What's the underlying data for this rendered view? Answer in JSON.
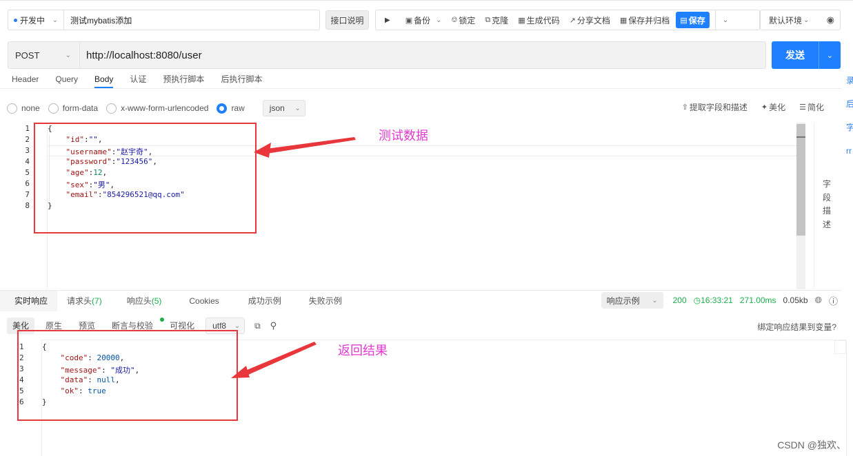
{
  "toolbar": {
    "status": "开发中",
    "api_name": "测试mybatis添加",
    "doc_button": "接口说明",
    "run_icon": "play-icon",
    "items": [
      {
        "icon": "backup-icon",
        "label": "备份"
      },
      {
        "icon": "lock-icon",
        "label": "锁定"
      },
      {
        "icon": "clone-icon",
        "label": "克隆"
      },
      {
        "icon": "code-icon",
        "label": "生成代码"
      },
      {
        "icon": "share-icon",
        "label": "分享文档"
      },
      {
        "icon": "archive-icon",
        "label": "保存并归档"
      }
    ],
    "save_label": "保存",
    "environment": "默认环境"
  },
  "request": {
    "method": "POST",
    "url": "http://localhost:8080/user",
    "send_label": "发送"
  },
  "request_tabs": [
    "Header",
    "Query",
    "Body",
    "认证",
    "预执行脚本",
    "后执行脚本"
  ],
  "body": {
    "types": [
      "none",
      "form-data",
      "x-www-form-urlencoded",
      "raw"
    ],
    "format": "json",
    "actions": [
      "提取字段和描述",
      "美化",
      "简化"
    ],
    "side_label": "字段描述",
    "line_numbers": [
      "1",
      "2",
      "3",
      "4",
      "5",
      "6",
      "7",
      "8"
    ],
    "fields": {
      "id": "\"\"",
      "username": "\"赵宇奇\"",
      "password": "\"123456\"",
      "age": "12",
      "sex": "\"男\"",
      "email": "\"854296521@qq.com\""
    }
  },
  "right_strip": [
    "录",
    "后",
    "字",
    "rr"
  ],
  "response": {
    "tabs": [
      {
        "label": "实时响应",
        "count": ""
      },
      {
        "label": "请求头",
        "count": "(7)"
      },
      {
        "label": "响应头",
        "count": "(5)"
      },
      {
        "label": "Cookies",
        "count": ""
      },
      {
        "label": "成功示例",
        "count": ""
      },
      {
        "label": "失败示例",
        "count": ""
      }
    ],
    "example_select": "响应示例",
    "status_code": "200",
    "time": "16:33:21",
    "duration": "271.00ms",
    "size": "0.05kb",
    "sub_tabs": [
      "美化",
      "原生",
      "预览",
      "断言与校验",
      "可视化"
    ],
    "encoding": "utf8",
    "bind_link": "绑定响应结果到变量?",
    "line_numbers": [
      "1",
      "2",
      "3",
      "4",
      "5",
      "6"
    ],
    "result": {
      "code": "20000",
      "message": "\"成功\"",
      "data": "null",
      "ok": "true"
    }
  },
  "annotations": {
    "test_data": "测试数据",
    "return_result": "返回结果",
    "color": "#e8363b",
    "text_color": "#e23ad1"
  },
  "watermark": "CSDN @独欢、"
}
